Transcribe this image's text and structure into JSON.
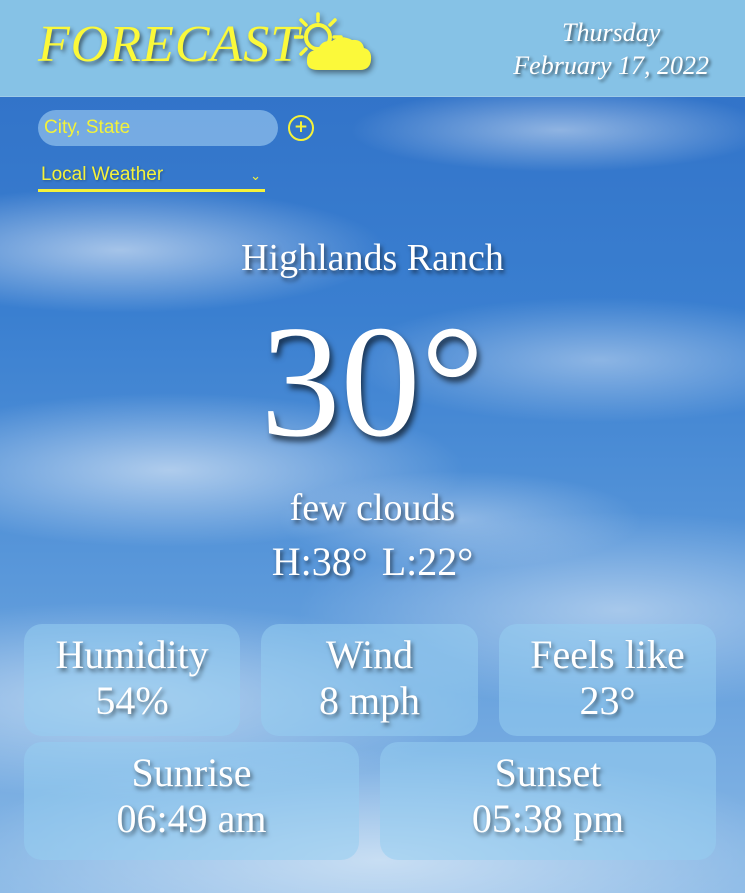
{
  "header": {
    "logo_text": "FORECAST",
    "logo_icon": "sun-cloud-icon",
    "day": "Thursday",
    "date": "February 17, 2022"
  },
  "search": {
    "placeholder": "City, State",
    "value": "",
    "add_icon": "plus-circle-icon"
  },
  "location_select": {
    "selected": "Local Weather",
    "chevron": "⌄"
  },
  "current": {
    "city": "Highlands Ranch",
    "temperature": "30°",
    "condition": "few clouds",
    "high": "H:38°",
    "low": "L:22°"
  },
  "stats": {
    "humidity": {
      "label": "Humidity",
      "value": "54%"
    },
    "wind": {
      "label": "Wind",
      "value": "8 mph"
    },
    "feels_like": {
      "label": "Feels like",
      "value": "23°"
    },
    "sunrise": {
      "label": "Sunrise",
      "value": "06:49 am"
    },
    "sunset": {
      "label": "Sunset",
      "value": "05:38 pm"
    }
  },
  "colors": {
    "accent_yellow": "#f5f23a",
    "header_bg": "#86c2e6",
    "sky_blue": "#3a7fd0",
    "text": "#ffffff"
  }
}
